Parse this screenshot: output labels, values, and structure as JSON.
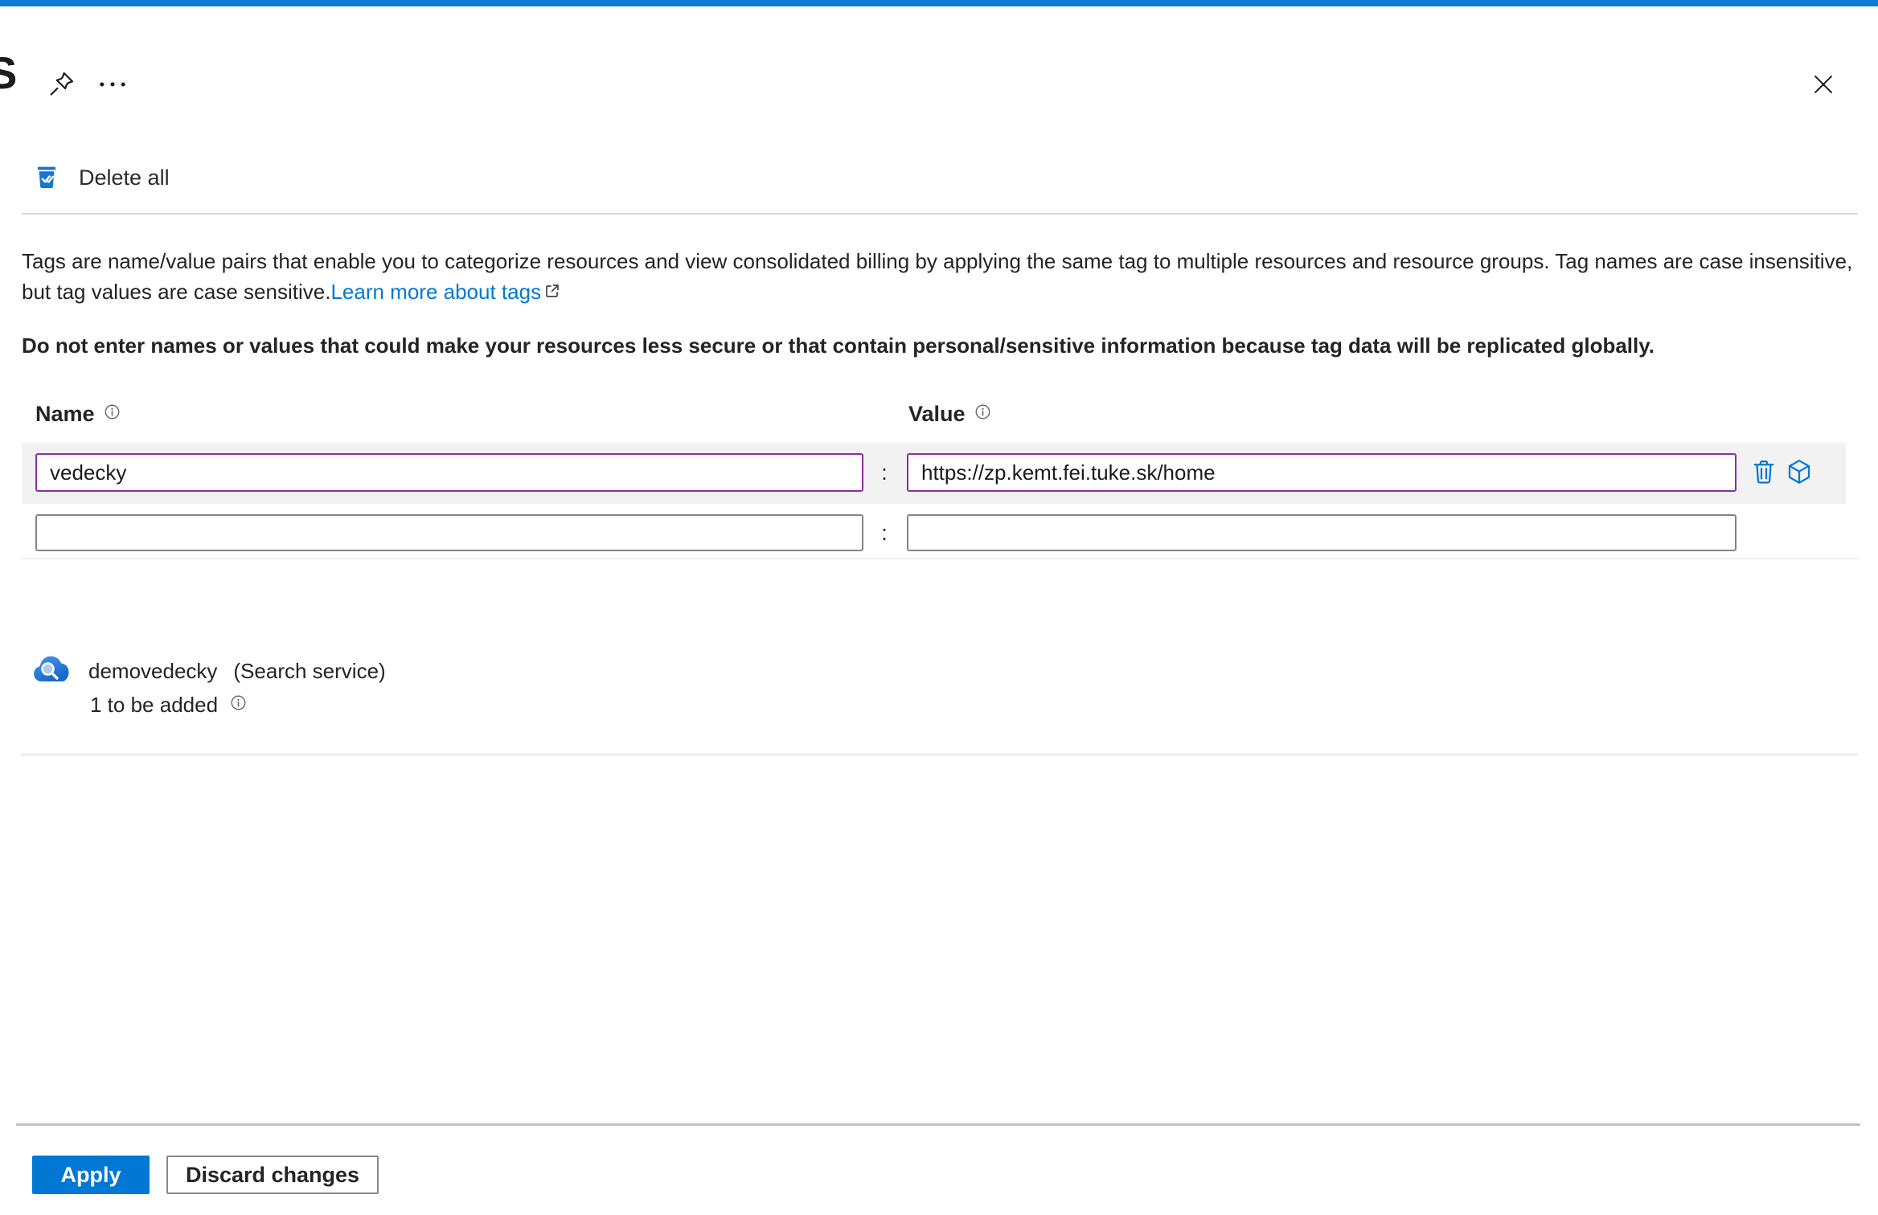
{
  "window": {
    "title_partial": "S"
  },
  "toolbar": {
    "pin_icon": "pushpin",
    "more_icon": "ellipsis",
    "close_icon": "close-x",
    "delete_all_label": "Delete all",
    "delete_all_icon": "trash-checked"
  },
  "intro": {
    "paragraph": "Tags are name/value pairs that enable you to categorize resources and view consolidated billing by applying the same tag to multiple resources and resource groups. Tag names are case insensitive, but tag values are case sensitive.",
    "link_label": "Learn more about tags",
    "link_icon": "external-link",
    "warning": "Do not enter names or values that could make your resources less secure or that contain personal/sensitive information because tag data will be replicated globally."
  },
  "tag_editor": {
    "name_header": "Name",
    "value_header": "Value",
    "header_info_icon": "info-circle",
    "separator": ":",
    "rows": [
      {
        "name": "vedecky",
        "value": "https://zp.kemt.fei.tuke.sk/home",
        "state": "modified"
      },
      {
        "name": "",
        "value": "",
        "state": "empty"
      }
    ],
    "row_action_icons": [
      "trash-outline",
      "cube-outline"
    ]
  },
  "resource": {
    "icon": "search-service-cloud",
    "name": "demovedecky",
    "type_label": "(Search service)",
    "pending_label": "1 to be added",
    "pending_info_icon": "info-circle"
  },
  "footer": {
    "apply_label": "Apply",
    "discard_label": "Discard changes"
  },
  "colors": {
    "accent_blue": "#0078d4",
    "modified_purple": "#8a2da5",
    "row_highlight": "#f2f2f2",
    "text_primary": "#252423"
  }
}
